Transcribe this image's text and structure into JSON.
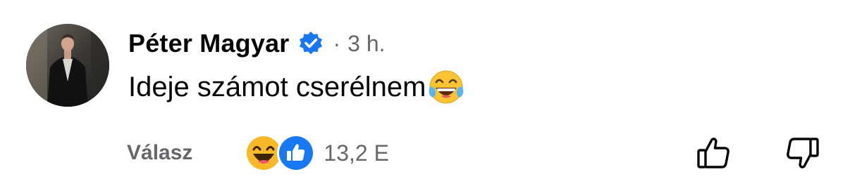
{
  "comment": {
    "author": "Péter Magyar",
    "separator": "·",
    "time": "3 h.",
    "text": "Ideje számot cserélnem",
    "text_emoji": "face-with-tears-of-joy-icon"
  },
  "actions": {
    "reply_label": "Válasz",
    "reaction_count": "13,2 E",
    "reaction_icons": [
      "haha-reaction-icon",
      "like-reaction-icon"
    ],
    "upvote_icon": "thumbs-up-icon",
    "downvote_icon": "thumbs-down-icon"
  },
  "colors": {
    "text": "#050505",
    "secondary": "#65676b",
    "verified_blue": "#1877f2",
    "like_blue": "#1877f2",
    "haha_yellow": "#f7b928"
  }
}
